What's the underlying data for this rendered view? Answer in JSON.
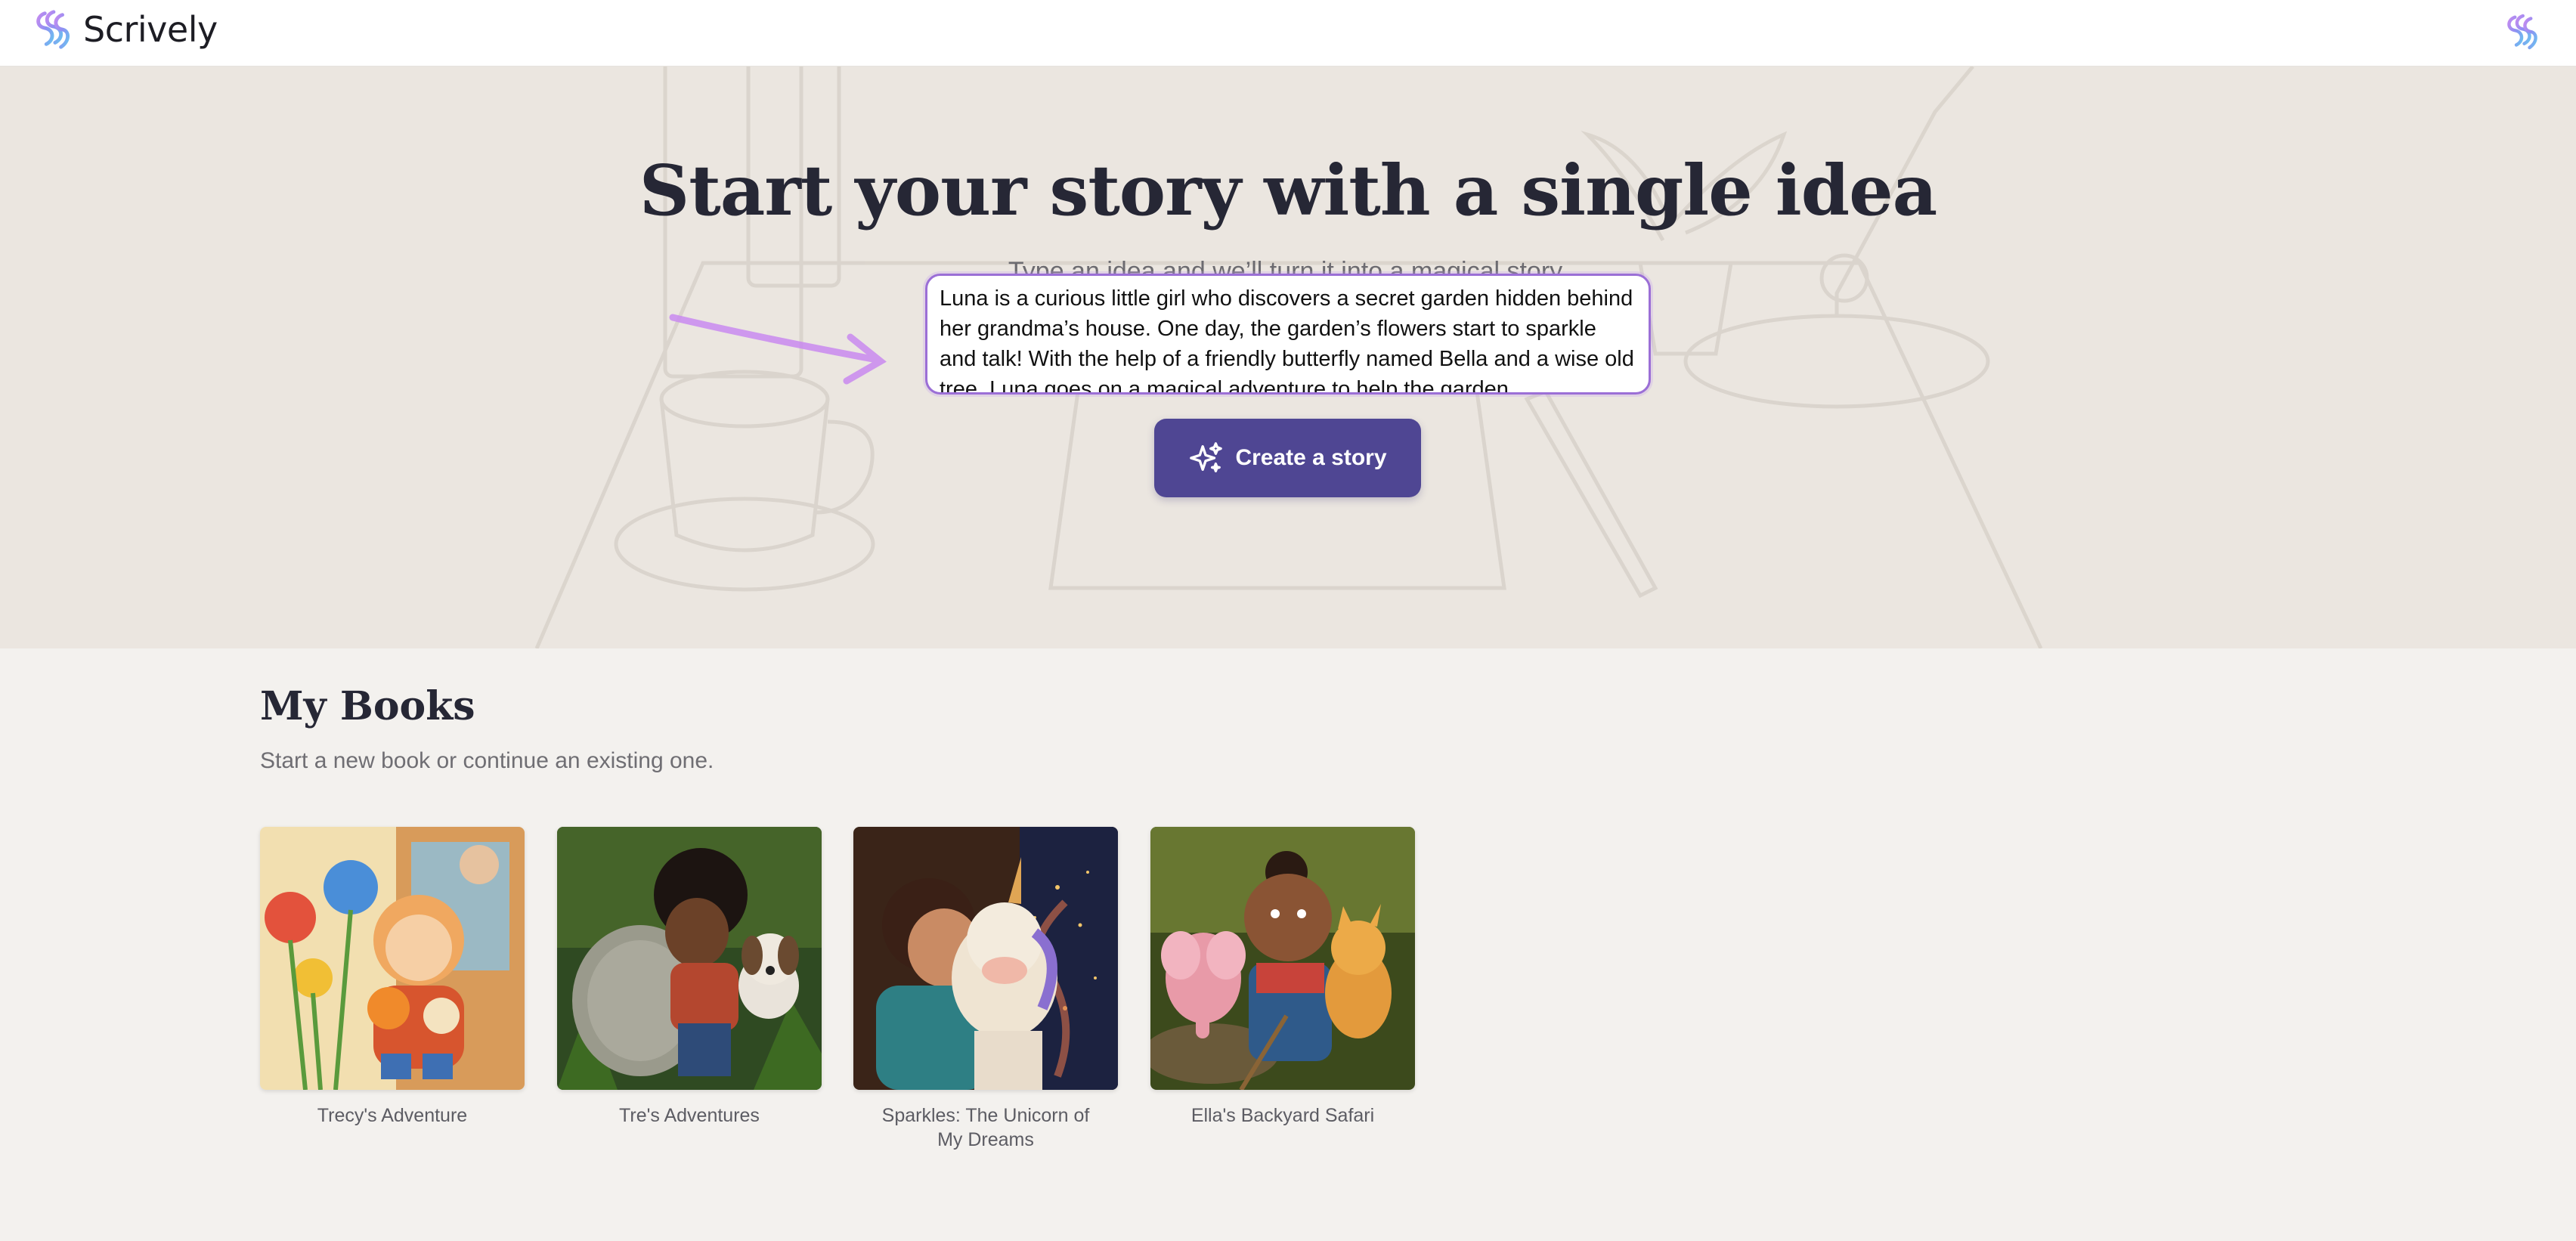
{
  "header": {
    "brand_name": "Scrively",
    "brand_icon": "scrively-swirl-logo-icon",
    "account_icon": "scrively-swirl-logo-icon"
  },
  "hero": {
    "title": "Start your story with a single idea",
    "subtitle": "Type an idea and we’ll turn it into a magical story.",
    "idea_value": "Luna is a curious little girl who discovers a secret garden hidden behind her grandma’s house. One day, the garden’s flowers start to sparkle and talk! With the help of a friendly butterfly named Bella and a wise old tree, Luna goes on a magical adventure to help the garden",
    "create_button_label": "Create a story",
    "create_button_icon": "sparkles-icon"
  },
  "books": {
    "title": "My Books",
    "subtitle": "Start a new book or continue an existing one.",
    "items": [
      {
        "title": "Trecy's Adventure"
      },
      {
        "title": "Tre's Adventures"
      },
      {
        "title": "Sparkles: The Unicorn of My Dreams"
      },
      {
        "title": "Ella's Backyard Safari"
      }
    ]
  },
  "colors": {
    "accent": "#4f4693",
    "input_border": "#9b6fd6",
    "hero_background": "#ebe6e0",
    "page_background": "#f3f1ee"
  }
}
